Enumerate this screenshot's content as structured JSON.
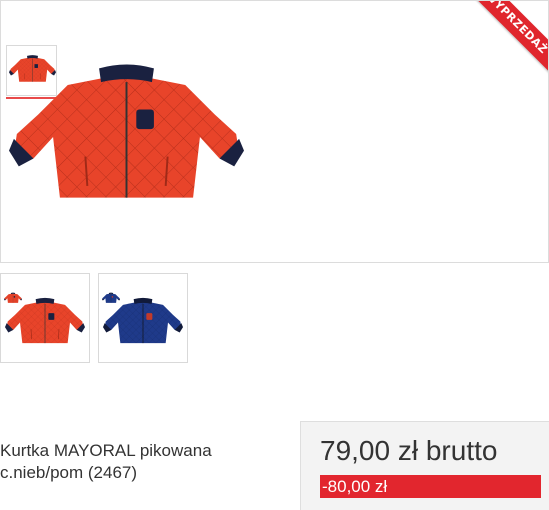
{
  "product": {
    "name": "Kurtka MAYORAL pikowana c.nieb/pom (2467)",
    "ribbon": "WYPRZEDAŻ",
    "price": "79,00 zł brutto",
    "discount": "-80,00 zł"
  },
  "colors": {
    "jacket_orange": "#e8442a",
    "jacket_navy": "#1f3a8a",
    "accent_red": "#e2262e",
    "price_bg": "#f3f3f3"
  },
  "gallery": [
    {
      "variant": "orange",
      "selected": true
    },
    {
      "variant": "navy",
      "selected": false
    }
  ]
}
